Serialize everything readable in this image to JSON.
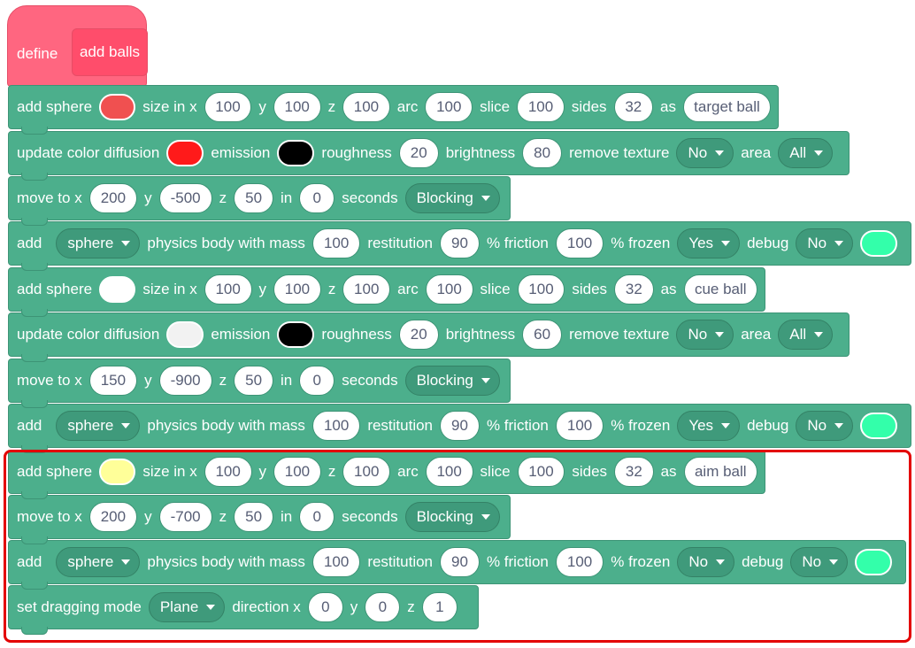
{
  "define": {
    "label": "define",
    "name": "add balls"
  },
  "labels": {
    "add_sphere": "add sphere",
    "size_in_x": "size in x",
    "y": "y",
    "z": "z",
    "arc": "arc",
    "slice": "slice",
    "sides": "sides",
    "as": "as",
    "update_color": "update color diffusion",
    "emission": "emission",
    "roughness": "roughness",
    "brightness": "brightness",
    "remove_texture": "remove texture",
    "area": "area",
    "move_to_x": "move to x",
    "in": "in",
    "seconds": "seconds",
    "add": "add",
    "physics_body": "physics body with mass",
    "restitution": "restitution",
    "friction": "% friction",
    "frozen": "% frozen",
    "debug": "debug",
    "set_dragging": "set dragging mode",
    "direction_x": "direction x"
  },
  "target": {
    "sphere": {
      "color": "#f05050",
      "x": "100",
      "y": "100",
      "z": "100",
      "arc": "100",
      "slice": "100",
      "sides": "32",
      "name": "target ball"
    },
    "color": {
      "diffusion": "#ff1a1a",
      "emission": "#000000",
      "roughness": "20",
      "brightness": "80",
      "remove_texture": "No",
      "area": "All"
    },
    "move": {
      "x": "200",
      "y": "-500",
      "z": "50",
      "secs": "0",
      "mode": "Blocking"
    },
    "physics": {
      "shape": "sphere",
      "mass": "100",
      "restitution": "90",
      "friction": "100",
      "frozen": "Yes",
      "debug": "No",
      "debug_color": "#33ffaa"
    }
  },
  "cue": {
    "sphere": {
      "color": "#ffffff",
      "x": "100",
      "y": "100",
      "z": "100",
      "arc": "100",
      "slice": "100",
      "sides": "32",
      "name": "cue ball"
    },
    "color": {
      "diffusion": "#f2f2f2",
      "emission": "#000000",
      "roughness": "20",
      "brightness": "60",
      "remove_texture": "No",
      "area": "All"
    },
    "move": {
      "x": "150",
      "y": "-900",
      "z": "50",
      "secs": "0",
      "mode": "Blocking"
    },
    "physics": {
      "shape": "sphere",
      "mass": "100",
      "restitution": "90",
      "friction": "100",
      "frozen": "Yes",
      "debug": "No",
      "debug_color": "#33ffaa"
    }
  },
  "aim": {
    "sphere": {
      "color": "#ffff99",
      "x": "100",
      "y": "100",
      "z": "100",
      "arc": "100",
      "slice": "100",
      "sides": "32",
      "name": "aim ball"
    },
    "move": {
      "x": "200",
      "y": "-700",
      "z": "50",
      "secs": "0",
      "mode": "Blocking"
    },
    "physics": {
      "shape": "sphere",
      "mass": "100",
      "restitution": "90",
      "friction": "100",
      "frozen": "No",
      "debug": "No",
      "debug_color": "#33ffaa"
    },
    "drag": {
      "mode": "Plane",
      "x": "0",
      "y": "0",
      "z": "1"
    }
  },
  "highlight_color": "#e30000"
}
